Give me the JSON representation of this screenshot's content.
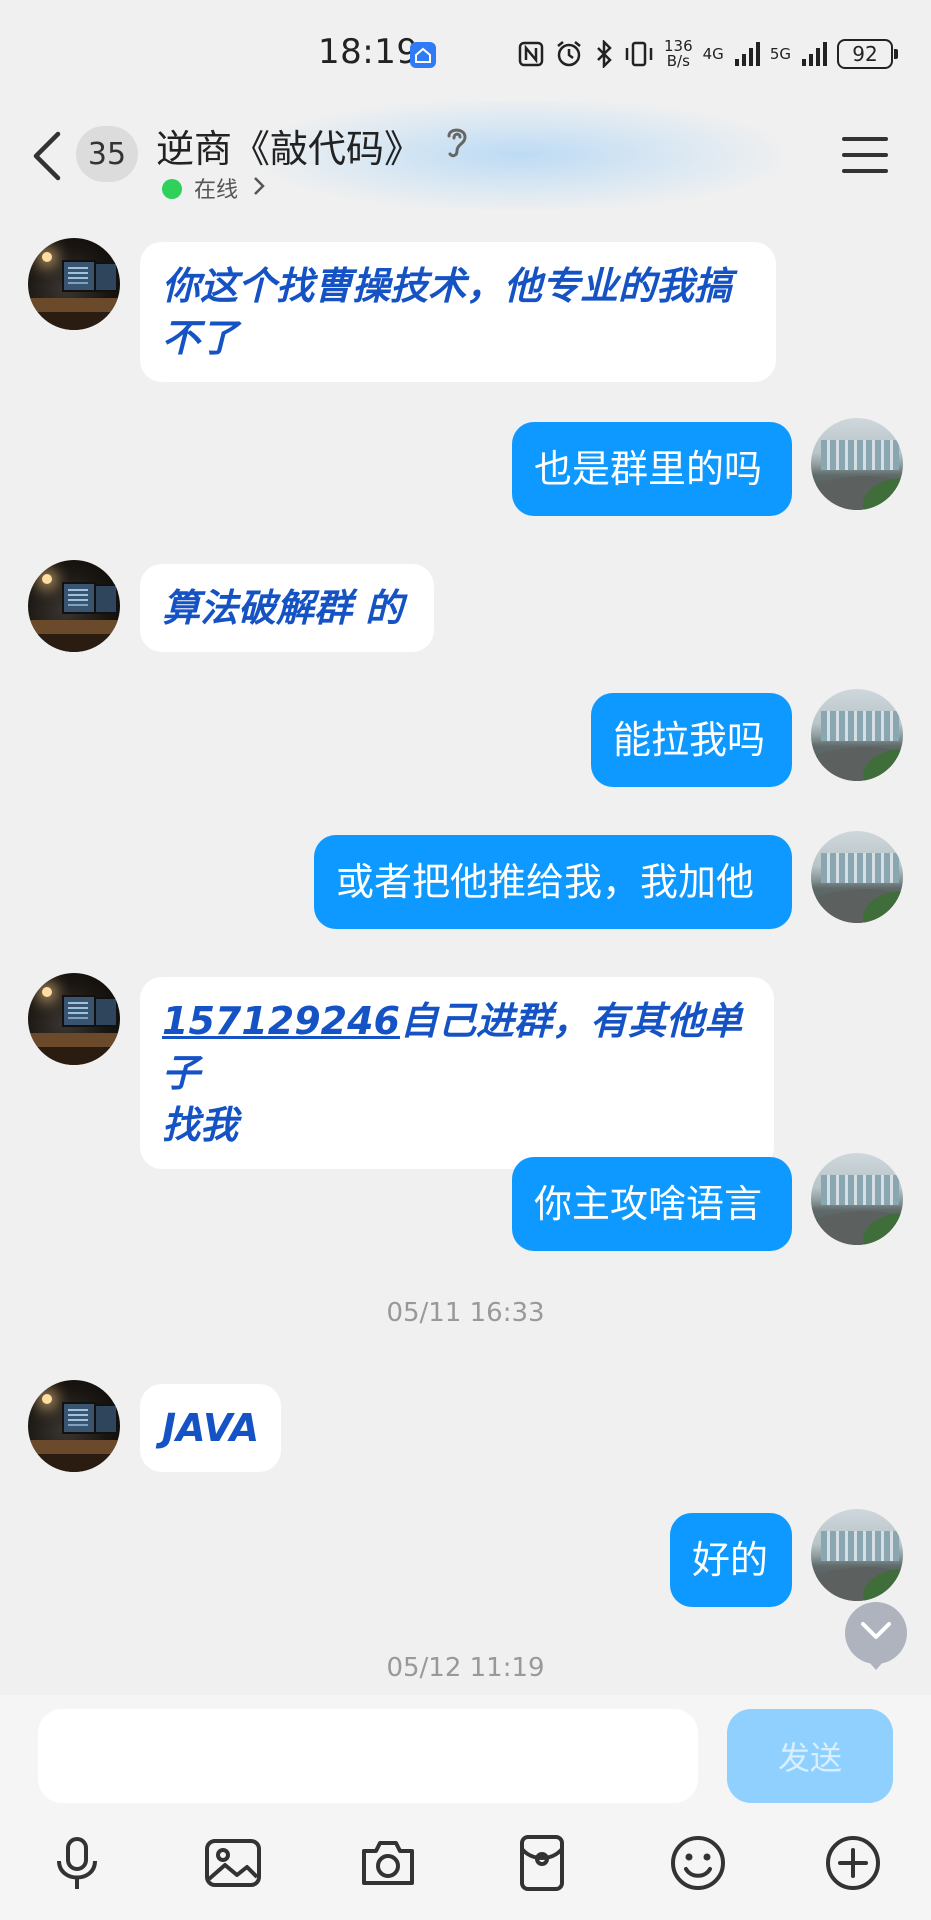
{
  "status_bar": {
    "time": "18:19",
    "net_speed_value": "136",
    "net_speed_unit": "B/s",
    "signal_1": "4G",
    "signal_2": "5G",
    "battery": "92"
  },
  "header": {
    "unread_count": "35",
    "title": "逆商《敲代码》",
    "status": "在线"
  },
  "messages": [
    {
      "from": "peer",
      "text": "你这个找曹操技术，他专业的我搞"
    },
    {
      "from": "peer",
      "text_line2": "不了"
    },
    {
      "from": "me",
      "text": "也是群里的吗"
    },
    {
      "from": "peer",
      "text": "算法破解群 的"
    },
    {
      "from": "me",
      "text": "能拉我吗"
    },
    {
      "from": "me",
      "text": "或者把他推给我，我加他"
    },
    {
      "from": "peer",
      "link": "157129246",
      "text": "自己进群，有其他单子",
      "text_line2": "找我"
    },
    {
      "from": "me",
      "text": "你主攻啥语言"
    },
    {
      "from": "peer",
      "text": "JAVA"
    },
    {
      "from": "me",
      "text": "好的"
    }
  ],
  "time_separators": [
    "05/11 16:33",
    "05/12 11:19"
  ],
  "input": {
    "value": "",
    "send_label": "发送"
  },
  "toolbar": [
    "mic-icon",
    "image-icon",
    "camera-icon",
    "red-packet-icon",
    "emoji-icon",
    "plus-icon"
  ],
  "colors": {
    "bubble_me": "#0d99ff",
    "bubble_peer_text": "#1553c4",
    "background": "#f0f0f0",
    "online": "#2fd15a"
  }
}
